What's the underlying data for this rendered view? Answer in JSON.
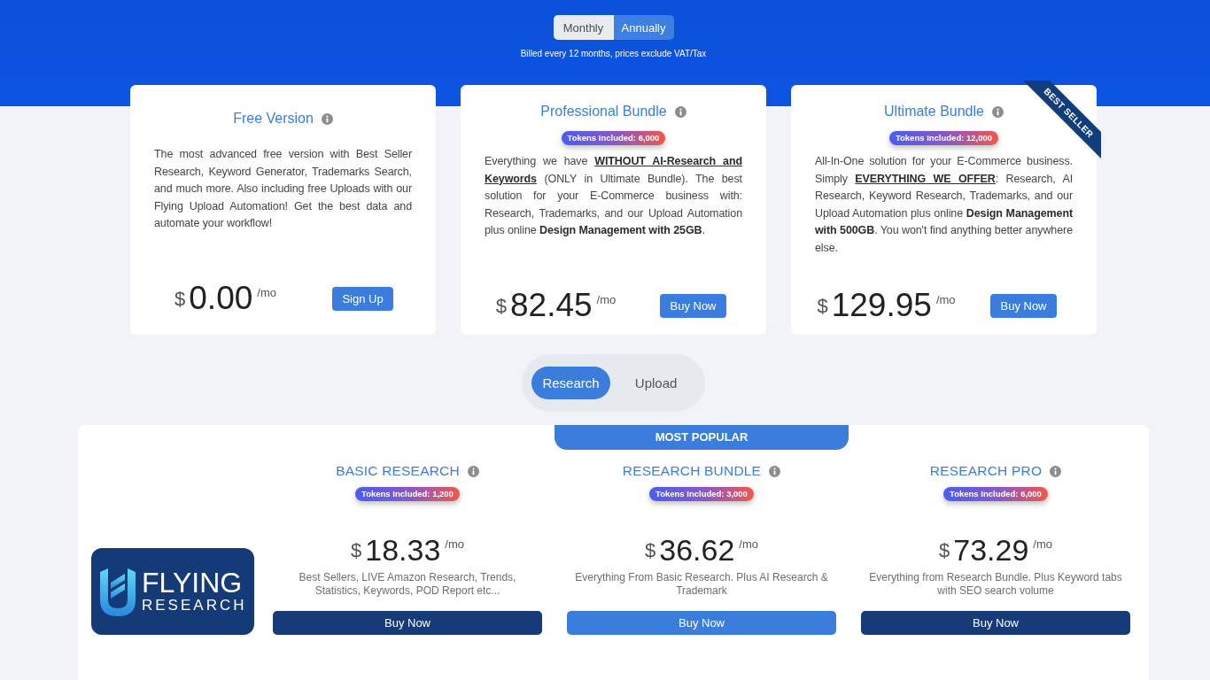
{
  "billing_toggle": {
    "options": [
      {
        "label": "Monthly",
        "selected": false
      },
      {
        "label": "Annually",
        "selected": true
      }
    ],
    "note": "Billed every 12 months, prices exclude VAT/Tax"
  },
  "bundles": [
    {
      "title": "Free Version",
      "description": [
        {
          "text": "The most advanced free version with Best Seller Research, Keyword Generator, Trademarks Search, and much more. Also including free Uploads with our Flying Upload Automation! Get the best data and automate your workflow!",
          "kind": "text"
        }
      ],
      "price": {
        "currency": "$",
        "amount": "0.00",
        "period": "/mo"
      },
      "button": "Sign Up"
    },
    {
      "title": "Professional Bundle",
      "tokens": "Tokens Included: 6,000",
      "description": [
        {
          "text": "Everything we have ",
          "kind": "text"
        },
        {
          "text": "WITHOUT AI-Research and Keywords",
          "kind": "key-phrase"
        },
        {
          "text": " (ONLY in Ultimate Bundle). The best solution for your E-Commerce business with: Research, Trademarks, and our Upload Automation plus online ",
          "kind": "text"
        },
        {
          "text": "Design Management with 25GB",
          "kind": "strong"
        },
        {
          "text": ".",
          "kind": "text"
        }
      ],
      "price": {
        "currency": "$",
        "amount": "82.45",
        "period": "/mo"
      },
      "button": "Buy Now"
    },
    {
      "title": "Ultimate Bundle",
      "ribbon": "BEST SELLER",
      "tokens": "Tokens Included: 12,000",
      "description": [
        {
          "text": "All-In-One solution for your E-Commerce business. Simply ",
          "kind": "text"
        },
        {
          "text": "EVERYTHING WE OFFER",
          "kind": "key-phrase"
        },
        {
          "text": ": Research, AI Research, Keyword Research, Trademarks, and our Upload Automation plus online ",
          "kind": "text"
        },
        {
          "text": "Design Management with 500GB",
          "kind": "strong"
        },
        {
          "text": ". You won't find anything better anywhere else.",
          "kind": "text"
        }
      ],
      "price": {
        "currency": "$",
        "amount": "129.95",
        "period": "/mo"
      },
      "button": "Buy Now"
    }
  ],
  "product_tabs": [
    {
      "label": "Research",
      "selected": true
    },
    {
      "label": "Upload",
      "selected": false
    }
  ],
  "research_panel": {
    "logo": {
      "name": "FLYING",
      "subtitle": "RESEARCH"
    },
    "plans": [
      {
        "title": "BASIC RESEARCH",
        "tokens": "Tokens Included: 1,200",
        "price": {
          "currency": "$",
          "amount": "18.33",
          "period": "/mo"
        },
        "description": "Best Sellers, LIVE Amazon Research, Trends, Statistics, Keywords, POD Report etc...",
        "button": "Buy Now",
        "featured": false
      },
      {
        "banner": "MOST POPULAR",
        "title": "RESEARCH BUNDLE",
        "tokens": "Tokens Included: 3,000",
        "price": {
          "currency": "$",
          "amount": "36.62",
          "period": "/mo"
        },
        "description": "Everything From Basic Research. Plus AI Research & Trademark",
        "button": "Buy Now",
        "featured": true
      },
      {
        "title": "RESEARCH PRO",
        "tokens": "Tokens Included: 6,000",
        "price": {
          "currency": "$",
          "amount": "73.29",
          "period": "/mo"
        },
        "description": "Everything from Research Bundle. Plus Keyword tabs with SEO search volume",
        "button": "Buy Now",
        "featured": false
      }
    ]
  }
}
